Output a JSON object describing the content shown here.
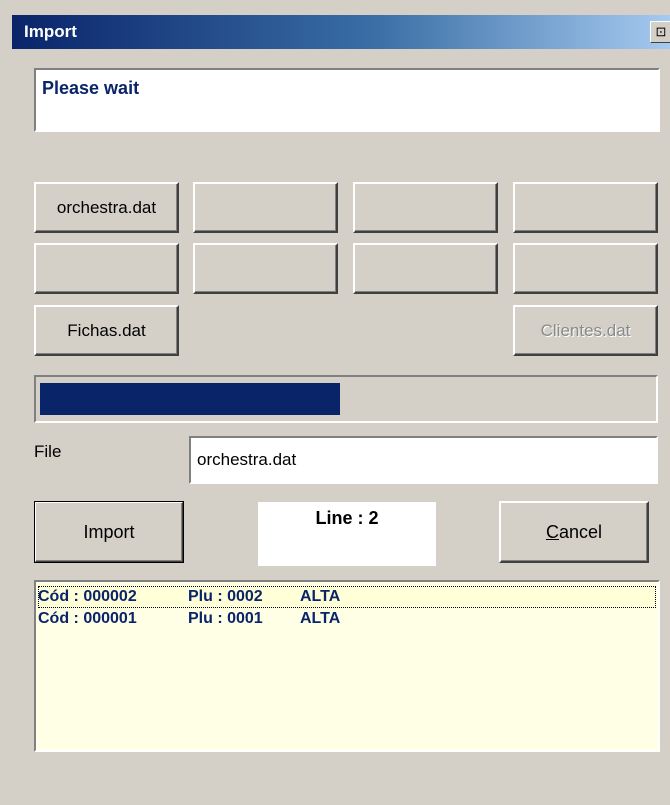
{
  "window": {
    "title": "Import",
    "title_button_glyph": "⊡",
    "title_button_icon": "restore-window-icon"
  },
  "status": {
    "message": "Please wait"
  },
  "file_buttons": {
    "row1": [
      "orchestra.dat",
      "",
      "",
      ""
    ],
    "row2": [
      "",
      "",
      "",
      ""
    ],
    "fichas": "Fichas.dat",
    "clientes": "Clientes.dat"
  },
  "progress": {
    "value_fraction": 0.49,
    "color": "#0a246a"
  },
  "file": {
    "label": "File",
    "value": "orchestra.dat"
  },
  "line_counter": {
    "text": "Line : 2"
  },
  "actions": {
    "import_label": "Import",
    "cancel_label": "Cancel",
    "cancel_accesskey": "C"
  },
  "log": {
    "rows": [
      {
        "code": "Cód : 000002",
        "plu": "Plu : 0002",
        "action": "ALTA"
      },
      {
        "code": "Cód : 000001",
        "plu": "Plu : 0001",
        "action": "ALTA"
      }
    ]
  },
  "colors": {
    "title_start": "#0a246a",
    "title_end": "#a6caf0",
    "text_accent": "#0a246a",
    "log_bg": "#ffffe5"
  }
}
